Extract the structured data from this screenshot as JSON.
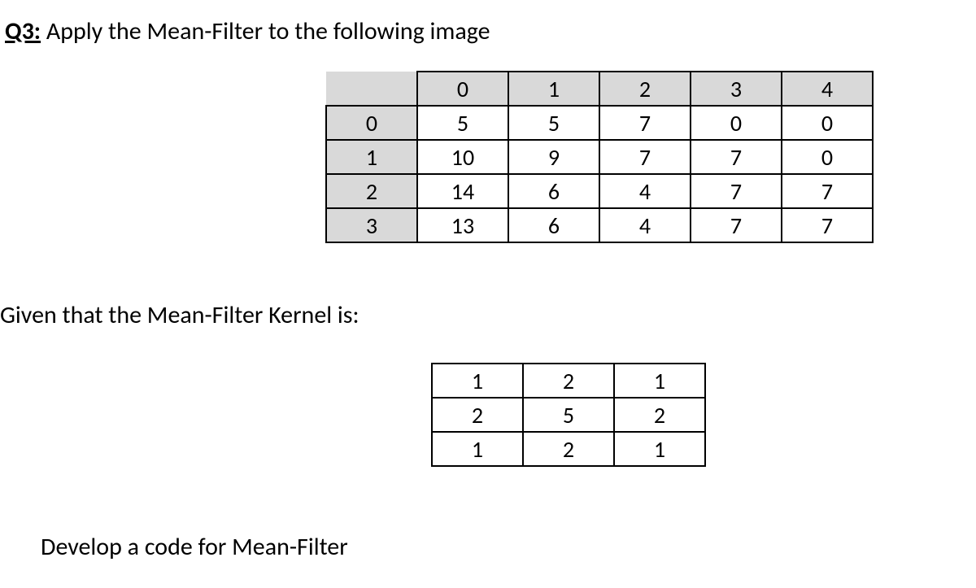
{
  "question": {
    "label": "Q3:",
    "text": " Apply the Mean-Filter to the following image"
  },
  "image_table": {
    "col_headers": [
      "0",
      "1",
      "2",
      "3",
      "4"
    ],
    "row_headers": [
      "0",
      "1",
      "2",
      "3"
    ],
    "rows": [
      [
        "5",
        "5",
        "7",
        "0",
        "0"
      ],
      [
        "10",
        "9",
        "7",
        "7",
        "0"
      ],
      [
        "14",
        "6",
        "4",
        "7",
        "7"
      ],
      [
        "13",
        "6",
        "4",
        "7",
        "7"
      ]
    ]
  },
  "kernel_intro": "Given that the Mean-Filter Kernel is:",
  "kernel_table": {
    "rows": [
      [
        "1",
        "2",
        "1"
      ],
      [
        "2",
        "5",
        "2"
      ],
      [
        "1",
        "2",
        "1"
      ]
    ]
  },
  "task_text": "Develop a code for Mean-Filter"
}
